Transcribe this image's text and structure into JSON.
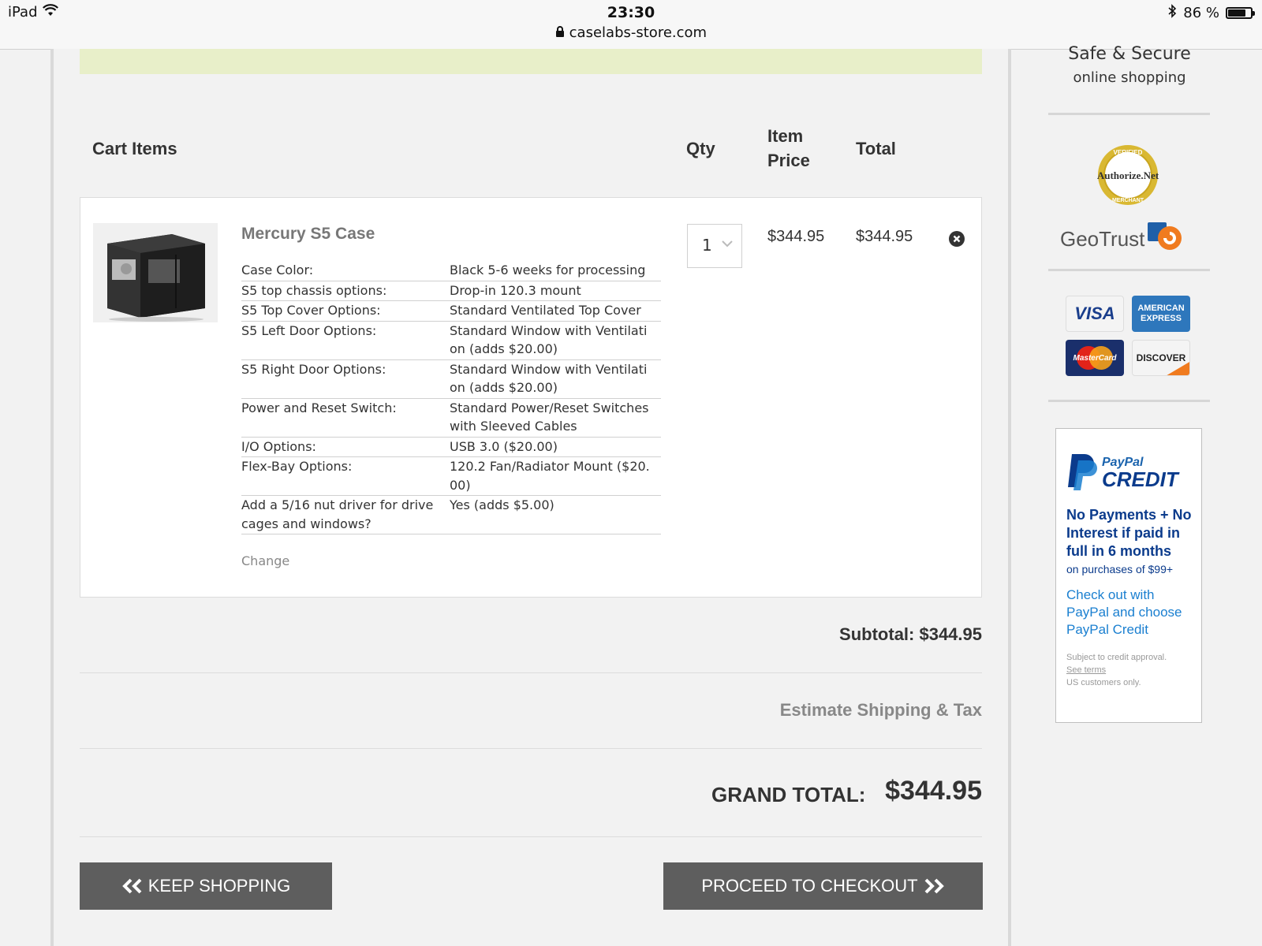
{
  "status_bar": {
    "device": "iPad",
    "time": "23:30",
    "url": "caselabs-store.com",
    "battery": "86 %",
    "battery_level": 0.86
  },
  "cart_header": {
    "items": "Cart Items",
    "qty": "Qty",
    "item_price_line1": "Item",
    "item_price_line2": "Price",
    "total": "Total"
  },
  "item": {
    "name": "Mercury S5 Case",
    "qty": "1",
    "item_price": "$344.95",
    "total": "$344.95",
    "change_label": "Change",
    "options": [
      {
        "label": "Case Color:",
        "value": "Black 5-6 weeks for processing"
      },
      {
        "label": "S5 top chassis options:",
        "value": "Drop-in 120.3 mount"
      },
      {
        "label": "S5 Top Cover Options:",
        "value": "Standard Ventilated Top Cover"
      },
      {
        "label": "S5 Left Door Options:",
        "value": "Standard Window with Ventilati on (adds $20.00)"
      },
      {
        "label": "S5 Right Door Options:",
        "value": "Standard Window with Ventilati on (adds $20.00)"
      },
      {
        "label": "Power and Reset Switch:",
        "value": "Standard Power/Reset Switches with Sleeved Cables"
      },
      {
        "label": "I/O Options:",
        "value": "USB 3.0 ($20.00)"
      },
      {
        "label": "Flex-Bay Options:",
        "value": "120.2 Fan/Radiator Mount ($20. 00)"
      },
      {
        "label": "Add a 5/16 nut driver for drive cages and windows?",
        "value": "Yes (adds $5.00)"
      }
    ]
  },
  "totals": {
    "subtotal": "Subtotal: $344.95",
    "estimate": "Estimate Shipping & Tax",
    "grand_label": "GRAND TOTAL:",
    "grand_value": "$344.95"
  },
  "buttons": {
    "keep_shopping": "KEEP SHOPPING",
    "checkout": "PROCEED TO CHECKOUT"
  },
  "sidebar": {
    "title": "Safe & Secure",
    "subtitle": "online shopping",
    "authnet_top": "VERIFIED",
    "authnet_brand": "Authorize.Net",
    "authnet_bottom": "MERCHANT",
    "geotrust": "GeoTrust",
    "cards": {
      "visa": "VISA",
      "amex_line1": "AMERICAN",
      "amex_line2": "EXPRESS",
      "mastercard": "MasterCard",
      "discover": "DISCOVER"
    },
    "paypal": {
      "brand": "PayPal",
      "credit": "CREDIT",
      "headline": "No Payments + No Interest if paid in full in 6 months",
      "sub": "on purchases of $99+",
      "cta": "Check out with PayPal and choose PayPal Credit",
      "fine1": "Subject to credit approval.",
      "fine_link": "See terms",
      "fine2": "US customers only."
    }
  },
  "colors": {
    "button_bg": "#5e5e5e",
    "notice_bg": "#e8efc9",
    "paypal_navy": "#0b3b8c",
    "paypal_blue": "#1a7fd0"
  }
}
